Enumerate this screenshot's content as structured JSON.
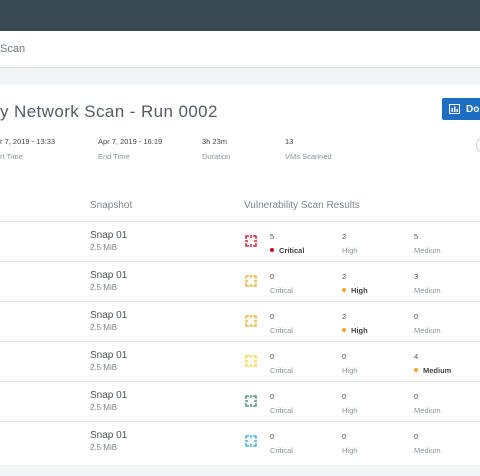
{
  "colors": {
    "critical": "#d0021b",
    "high": "#f5a623",
    "medium": "#f5a623",
    "topbar": "#3a4a53",
    "accent": "#1b6ec2"
  },
  "breadcrumb": "Scan",
  "title": "y Network Scan - Run 0002",
  "download_label": "Do",
  "stats": [
    {
      "value": "r 7, 2019 - 13:33",
      "label": "rt Time"
    },
    {
      "value": "Apr 7, 2019 - 16:19",
      "label": "End Time"
    },
    {
      "value": "3h 23m",
      "label": "Duration"
    },
    {
      "value": "13",
      "label": "VMs Scanned"
    }
  ],
  "columns": {
    "snapshot": "Snapshot",
    "results": "Vulnerability Scan Results"
  },
  "rows": [
    {
      "snapshot": "Snap 01",
      "size": "2.5 MiB",
      "icon": "severity-critical-icon",
      "icon_color": "#d0021b",
      "critical": "5",
      "high": "2",
      "medium": "5",
      "critical_label": "Critical",
      "high_label": "High",
      "medium_label": "Medium",
      "top": "critical"
    },
    {
      "snapshot": "Snap 01",
      "size": "2.5 MiB",
      "icon": "severity-high-icon",
      "icon_color": "#f5a623",
      "critical": "0",
      "high": "2",
      "medium": "3",
      "critical_label": "Critical",
      "high_label": "High",
      "medium_label": "Medium",
      "top": "high"
    },
    {
      "snapshot": "Snap 01",
      "size": "2.5 MiB",
      "icon": "severity-high-icon",
      "icon_color": "#f5a623",
      "critical": "0",
      "high": "2",
      "medium": "0",
      "critical_label": "Critical",
      "high_label": "High",
      "medium_label": "Medium",
      "top": "high"
    },
    {
      "snapshot": "Snap 01",
      "size": "2.5 MiB",
      "icon": "severity-medium-icon",
      "icon_color": "#f8d12f",
      "critical": "0",
      "high": "0",
      "medium": "4",
      "critical_label": "Critical",
      "high_label": "High",
      "medium_label": "Medium",
      "top": "medium"
    },
    {
      "snapshot": "Snap 01",
      "size": "2.5 MiB",
      "icon": "severity-none-icon",
      "icon_color": "#2e8b57",
      "critical": "0",
      "high": "0",
      "medium": "0",
      "critical_label": "Critical",
      "high_label": "High",
      "medium_label": "Medium",
      "top": ""
    },
    {
      "snapshot": "Snap 01",
      "size": "2.5 MiB",
      "icon": "severity-info-icon",
      "icon_color": "#2aa3d8",
      "critical": "0",
      "high": "0",
      "medium": "0",
      "critical_label": "Critical",
      "high_label": "High",
      "medium_label": "Medium",
      "top": ""
    }
  ]
}
